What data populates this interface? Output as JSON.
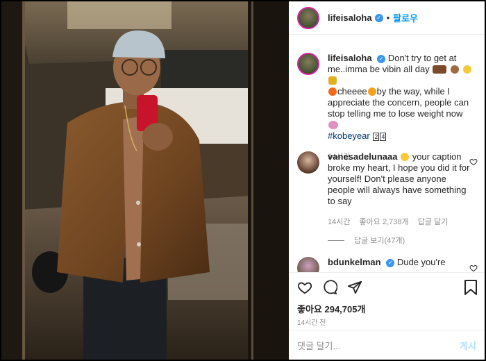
{
  "header": {
    "username": "lifeisaloha",
    "dot": "•",
    "follow_label": "팔로우"
  },
  "caption": {
    "username": "lifeisaloha",
    "text_1": "Don't try to get at me..imma be vibin all day",
    "text_2": "cheeee",
    "text_3": "by the way, while I appreciate the concern, people can stop telling me to lose weight now",
    "hashtag": "#kobeyear",
    "badge_1": "2",
    "badge_2": "4",
    "time": "14시간"
  },
  "comment_1": {
    "username": "vanesadelunaaa",
    "text": "your caption broke my heart, I hope you did it for yourself! Don't please anyone people will always have something to say",
    "time": "14시간",
    "likes": "좋아요 2,738개",
    "reply": "답글 달기",
    "view_replies": "답글 보기(47개)"
  },
  "comment_2": {
    "username": "bdunkelman",
    "text": "Dude you're"
  },
  "actions": {
    "likes": "좋아요 294,705개",
    "time": "14시간 전"
  },
  "add_comment": {
    "placeholder": "댓글 달기...",
    "post_label": "게시"
  },
  "colors": {
    "accent": "#0095f6",
    "verified": "#3897f0",
    "hashtag": "#00376b",
    "muted": "#8e8e8e"
  }
}
